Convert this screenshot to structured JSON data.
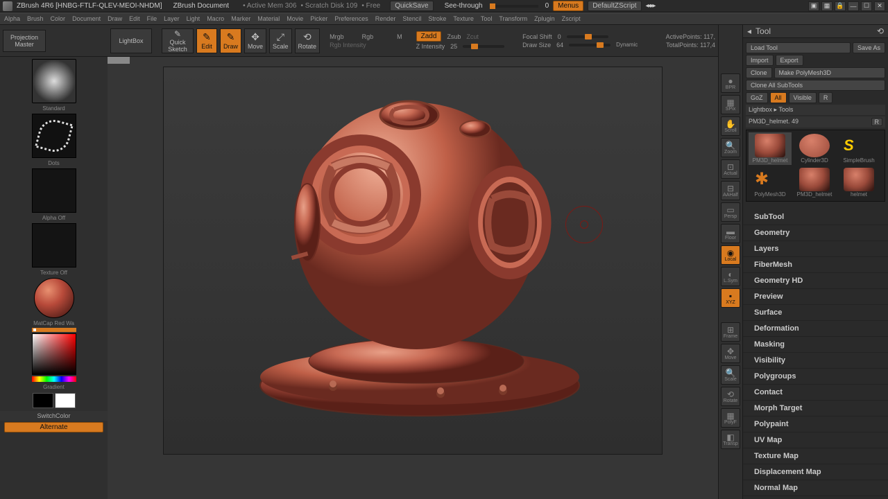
{
  "titlebar": {
    "app": "ZBrush 4R6 [HNBG-FTLF-QLEV-MEOI-NHDM]",
    "doc": "ZBrush Document",
    "mem": "• Active Mem 306",
    "scratch": "• Scratch Disk 109",
    "free": "• Free",
    "quicksave": "QuickSave",
    "see": "See-through",
    "see_v": "0",
    "menus": "Menus",
    "script": "DefaultZScript"
  },
  "menus": [
    "Alpha",
    "Brush",
    "Color",
    "Document",
    "Draw",
    "Edit",
    "File",
    "Layer",
    "Light",
    "Macro",
    "Marker",
    "Material",
    "Movie",
    "Picker",
    "Preferences",
    "Render",
    "Stencil",
    "Stroke",
    "Texture",
    "Tool",
    "Transform",
    "Zplugin",
    "Zscript"
  ],
  "toolbar": {
    "pm": "Projection\nMaster",
    "lightbox": "LightBox",
    "qs": "Quick\nSketch",
    "edit": "Edit",
    "draw": "Draw",
    "move": "Move",
    "scale": "Scale",
    "rotate": "Rotate",
    "mrgb": "Mrgb",
    "rgb": "Rgb",
    "m": "M",
    "rgbint": "Rgb Intensity",
    "zadd": "Zadd",
    "zsub": "Zsub",
    "zcut": "Zcut",
    "zint": "Z Intensity",
    "zint_v": "25",
    "focal": "Focal Shift",
    "focal_v": "0",
    "drawsize": "Draw Size",
    "drawsize_v": "64",
    "dynamic": "Dynamic",
    "active": "ActivePoints:",
    "active_v": "117,",
    "total": "TotalPoints:",
    "total_v": "117,4"
  },
  "left": {
    "brush": "Standard",
    "stroke": "Dots",
    "alpha": "Alpha Off",
    "tex": "Texture Off",
    "mat": "MatCap Red Wa",
    "grad": "Gradient",
    "switch": "SwitchColor",
    "alt": "Alternate"
  },
  "nav": [
    "BPR",
    "SPix",
    "Scroll",
    "Zoom",
    "Actual",
    "AAHalf",
    "Persp",
    "Floor",
    "Local",
    "L.Sym",
    "XYZ",
    "",
    "",
    "Frame",
    "Move",
    "Scale",
    "Rotate",
    "PolyF",
    "Transp"
  ],
  "nav_active": {
    "Local": true,
    "XYZ": true
  },
  "tool_panel": {
    "title": "Tool",
    "loadtool": "Load Tool",
    "saveas": "Save As",
    "import": "Import",
    "export": "Export",
    "clone": "Clone",
    "makepm": "Make PolyMesh3D",
    "cloneall": "Clone All SubTools",
    "goz": "GoZ",
    "all": "All",
    "visible": "Visible",
    "r": "R",
    "lightbox": "Lightbox ▸ Tools",
    "current": "PM3D_helmet. 49",
    "tools": [
      {
        "n": "PM3D_helmet",
        "t": "helmet",
        "sel": true
      },
      {
        "n": "Cylinder3D",
        "t": "cyl"
      },
      {
        "n": "SimpleBrush",
        "t": "s"
      },
      {
        "n": "PolyMesh3D",
        "t": "star"
      },
      {
        "n": "PM3D_helmet",
        "t": "helmet"
      },
      {
        "n": "helmet",
        "t": "helmet"
      }
    ]
  },
  "accordion": [
    "SubTool",
    "Geometry",
    "Layers",
    "FiberMesh",
    "Geometry HD",
    "Preview",
    "Surface",
    "Deformation",
    "Masking",
    "Visibility",
    "Polygroups",
    "Contact",
    "Morph Target",
    "Polypaint",
    "UV Map",
    "Texture Map",
    "Displacement Map",
    "Normal Map"
  ]
}
